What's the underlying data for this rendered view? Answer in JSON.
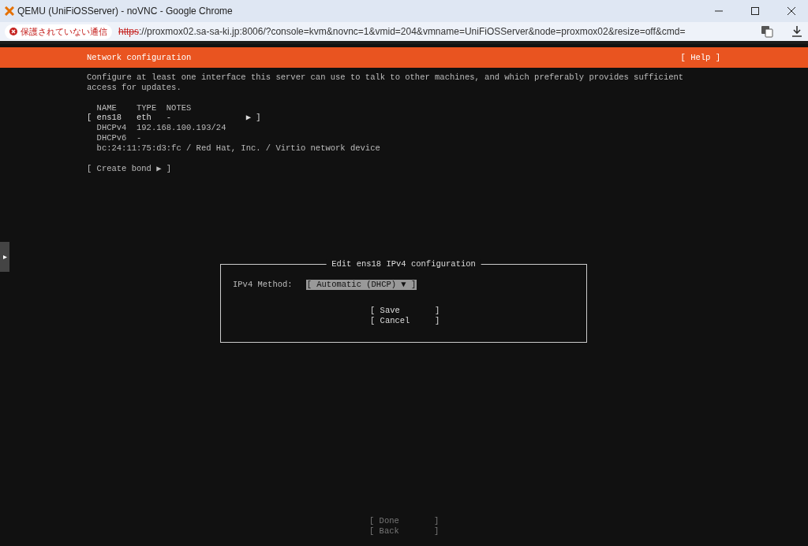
{
  "browser": {
    "title": "QEMU (UniFiOSServer) - noVNC - Google Chrome",
    "security_label": "保護されていない通信",
    "url_scheme": "https",
    "url_rest": "://proxmox02.sa-sa-ki.jp:8006/?console=kvm&novnc=1&vmid=204&vmname=UniFiOSServer&node=proxmox02&resize=off&cmd="
  },
  "header": {
    "title": "Network configuration",
    "help": "[ Help ]"
  },
  "description": [
    "Configure at least one interface this server can use to talk to other machines, and which preferably provides sufficient",
    "access for updates."
  ],
  "interfaces": {
    "heading": "  NAME    TYPE  NOTES",
    "lines": [
      {
        "text": "[ ens18   eth   -               ▶ ]",
        "kind": "row"
      },
      {
        "text": "  DHCPv4  192.168.100.193/24",
        "kind": "detail"
      },
      {
        "text": "  DHCPv6  -",
        "kind": "detail"
      },
      {
        "text": "  bc:24:11:75:d3:fc / Red Hat, Inc. / Virtio network device",
        "kind": "detail"
      }
    ]
  },
  "create_bond": "[ Create bond ▶ ]",
  "dialog": {
    "title": "Edit ens18 IPv4 configuration",
    "field_label": "IPv4 Method:",
    "dropdown": {
      "value": "[ Automatic (DHCP) ▼ ]",
      "selected": true
    },
    "buttons": [
      {
        "label": "[ Save       ]",
        "disabled": false
      },
      {
        "label": "[ Cancel     ]",
        "disabled": false
      }
    ]
  },
  "footer_buttons": [
    {
      "label": "[ Done       ]",
      "disabled": true
    },
    {
      "label": "[ Back       ]",
      "disabled": true
    }
  ]
}
